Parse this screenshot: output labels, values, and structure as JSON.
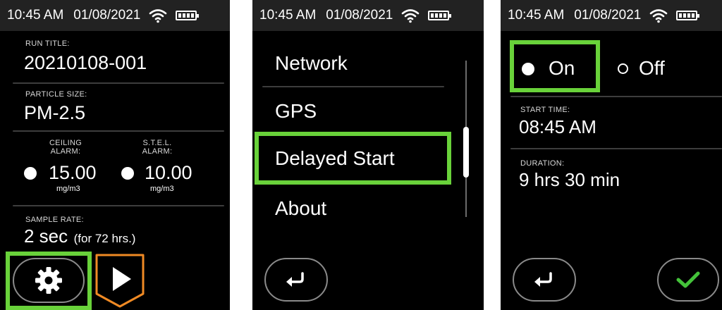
{
  "status_bar": {
    "time": "10:45 AM",
    "date": "01/08/2021"
  },
  "screen1": {
    "run_title_label": "RUN TITLE:",
    "run_title": "20210108-001",
    "particle_size_label": "PARTICLE SIZE:",
    "particle_size": "PM-2.5",
    "ceiling_alarm_label_1": "CEILING",
    "ceiling_alarm_label_2": "ALARM:",
    "ceiling_alarm_value": "15.00",
    "ceiling_alarm_unit": "mg/m3",
    "stel_alarm_label_1": "S.T.E.L.",
    "stel_alarm_label_2": "ALARM:",
    "stel_alarm_value": "10.00",
    "stel_alarm_unit": "mg/m3",
    "sample_rate_label": "SAMPLE RATE:",
    "sample_rate": "2 sec",
    "sample_rate_note": "(for 72 hrs.)"
  },
  "screen2": {
    "menu": [
      "Network",
      "GPS",
      "Delayed Start",
      "About"
    ],
    "selected": "Delayed Start"
  },
  "screen3": {
    "on_label": "On",
    "off_label": "Off",
    "selected": "On",
    "start_time_label": "START TIME:",
    "start_time": "08:45 AM",
    "duration_label": "DURATION:",
    "duration": "9 hrs 30 min"
  },
  "colors": {
    "highlight": "#69d23a",
    "play_accent": "#f08a24",
    "confirm": "#44c23a"
  },
  "icons": [
    "wifi-icon",
    "battery-icon",
    "gear-icon",
    "play-icon",
    "back-arrow-icon",
    "checkmark-icon"
  ]
}
